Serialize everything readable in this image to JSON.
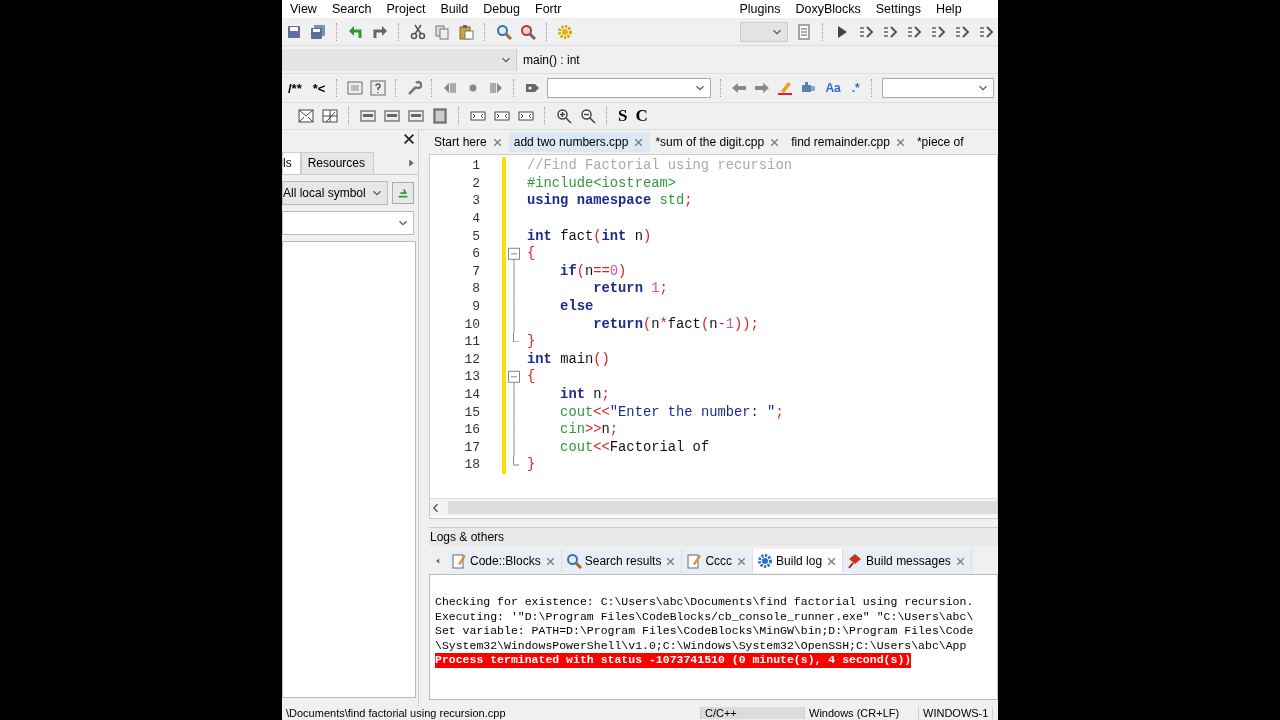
{
  "menu": [
    {
      "label": "View"
    },
    {
      "label": "Search"
    },
    {
      "label": "Project"
    },
    {
      "label": "Build"
    },
    {
      "label": "Debug"
    },
    {
      "label": "Fortr"
    },
    {
      "label": "Plugins"
    },
    {
      "label": "DoxyBlocks"
    },
    {
      "label": "Settings"
    },
    {
      "label": "Help"
    }
  ],
  "toolbars": {
    "comment_buttons": [
      "/**",
      "*<"
    ],
    "regex_buttons": [
      "Aa",
      ".*"
    ],
    "style_buttons": [
      "S",
      "C"
    ],
    "function_field": "main() : int"
  },
  "management": {
    "tabs": [
      {
        "label": "ls",
        "selected": true
      },
      {
        "label": "Resources",
        "selected": false
      }
    ],
    "symbol_filter": "All local symbol"
  },
  "editor_tabs": [
    {
      "label": "Start here",
      "selected": false,
      "closable": true
    },
    {
      "label": "add two numbers.cpp",
      "selected": true,
      "closable": true
    },
    {
      "label": "*sum of the digit.cpp",
      "selected": false,
      "closable": true
    },
    {
      "label": "find remainder.cpp",
      "selected": false,
      "closable": true
    },
    {
      "label": "*piece of",
      "selected": false,
      "closable": false
    }
  ],
  "code_lines": [
    {
      "n": "1",
      "changed": true,
      "tokens": [
        {
          "kind": "comment",
          "text": "//Find Factorial using recursion"
        }
      ]
    },
    {
      "n": "2",
      "changed": true,
      "tokens": [
        {
          "kind": "pre",
          "text": "#include<iostream>"
        }
      ]
    },
    {
      "n": "3",
      "changed": true,
      "tokens": [
        {
          "kind": "kw",
          "text": "using namespace "
        },
        {
          "kind": "lib",
          "text": "std"
        },
        {
          "kind": "op",
          "text": ";"
        }
      ]
    },
    {
      "n": "4",
      "changed": true
    },
    {
      "n": "5",
      "changed": true,
      "tokens": [
        {
          "kind": "kw",
          "text": "int "
        },
        {
          "kind": "plain",
          "text": "fact"
        },
        {
          "kind": "op",
          "text": "("
        },
        {
          "kind": "kw",
          "text": "int "
        },
        {
          "kind": "plain",
          "text": "n"
        },
        {
          "kind": "op",
          "text": ")"
        }
      ]
    },
    {
      "n": "6",
      "kind": "fold_start",
      "changed": true,
      "tokens": [
        {
          "kind": "op",
          "text": "{"
        }
      ]
    },
    {
      "n": "7",
      "kind": "fold_body",
      "changed": true,
      "tokens": [
        {
          "kind": "kw",
          "text": "    if"
        },
        {
          "kind": "op",
          "text": "("
        },
        {
          "kind": "plain",
          "text": "n"
        },
        {
          "kind": "op",
          "text": "=="
        },
        {
          "kind": "num",
          "text": "0"
        },
        {
          "kind": "op",
          "text": ")"
        }
      ]
    },
    {
      "n": "8",
      "kind": "fold_body",
      "changed": true,
      "tokens": [
        {
          "kind": "kw",
          "text": "        return "
        },
        {
          "kind": "num",
          "text": "1"
        },
        {
          "kind": "op",
          "text": ";"
        }
      ]
    },
    {
      "n": "9",
      "kind": "fold_body",
      "changed": true,
      "tokens": [
        {
          "kind": "kw",
          "text": "    else"
        }
      ]
    },
    {
      "n": "10",
      "kind": "fold_body",
      "changed": true,
      "tokens": [
        {
          "kind": "kw",
          "text": "        return"
        },
        {
          "kind": "op",
          "text": "("
        },
        {
          "kind": "plain",
          "text": "n"
        },
        {
          "kind": "op",
          "text": "*"
        },
        {
          "kind": "plain",
          "text": "fact"
        },
        {
          "kind": "op",
          "text": "("
        },
        {
          "kind": "plain",
          "text": "n"
        },
        {
          "kind": "op",
          "text": "-"
        },
        {
          "kind": "num",
          "text": "1"
        },
        {
          "kind": "op",
          "text": "));"
        }
      ]
    },
    {
      "n": "11",
      "kind": "fold_end",
      "changed": true,
      "tokens": [
        {
          "kind": "op",
          "text": "}"
        }
      ]
    },
    {
      "n": "12",
      "changed": true,
      "tokens": [
        {
          "kind": "kw",
          "text": "int "
        },
        {
          "kind": "plain",
          "text": "main"
        },
        {
          "kind": "op",
          "text": "()"
        }
      ]
    },
    {
      "n": "13",
      "kind": "fold_start",
      "changed": true,
      "tokens": [
        {
          "kind": "op",
          "text": "{"
        }
      ]
    },
    {
      "n": "14",
      "kind": "fold_body",
      "changed": true,
      "tokens": [
        {
          "kind": "kw",
          "text": "    int "
        },
        {
          "kind": "plain",
          "text": "n"
        },
        {
          "kind": "op",
          "text": ";"
        }
      ]
    },
    {
      "n": "15",
      "kind": "fold_body",
      "changed": true,
      "tokens": [
        {
          "kind": "lib",
          "text": "    cout"
        },
        {
          "kind": "op",
          "text": "<<"
        },
        {
          "kind": "str",
          "text": "\"Enter the number: \""
        },
        {
          "kind": "op",
          "text": ";"
        }
      ]
    },
    {
      "n": "16",
      "kind": "fold_body",
      "changed": true,
      "tokens": [
        {
          "kind": "lib",
          "text": "    cin"
        },
        {
          "kind": "op",
          "text": ">>"
        },
        {
          "kind": "plain",
          "text": "n"
        },
        {
          "kind": "op",
          "text": ";"
        }
      ]
    },
    {
      "n": "17",
      "kind": "fold_body",
      "changed": true,
      "tokens": [
        {
          "kind": "lib",
          "text": "    cout"
        },
        {
          "kind": "op",
          "text": "<<"
        },
        {
          "kind": "plain",
          "text": "Factorial of"
        }
      ]
    },
    {
      "n": "18",
      "kind": "fold_end",
      "changed": true,
      "tokens": [
        {
          "kind": "op",
          "text": "}"
        }
      ]
    }
  ],
  "logs": {
    "title": "Logs & others",
    "tabs": [
      {
        "label": "Code::Blocks",
        "kind": "note",
        "selected": false
      },
      {
        "label": "Search results",
        "kind": "search",
        "selected": false
      },
      {
        "label": "Cccc",
        "kind": "note",
        "selected": false
      },
      {
        "label": "Build log",
        "kind": "gear",
        "selected": true
      },
      {
        "label": "Build messages",
        "kind": "pin",
        "selected": false
      }
    ],
    "lines": [
      {
        "kind": "info",
        "text": "Checking for existence: C:\\Users\\abc\\Documents\\find factorial using recursion."
      },
      {
        "kind": "info",
        "text": "Executing: '\"D:\\Program Files\\CodeBlocks/cb_console_runner.exe\" \"C:\\Users\\abc\\"
      },
      {
        "kind": "info",
        "text": "Set variable: PATH=D:\\Program Files\\CodeBlocks\\MinGW\\bin;D:\\Program Files\\Code"
      },
      {
        "kind": "info",
        "text": "\\System32\\WindowsPowerShell\\v1.0;C:\\Windows\\System32\\OpenSSH;C:\\Users\\abc\\App"
      },
      {
        "kind": "error",
        "text": "Process terminated with status -1073741510 (0 minute(s), 4 second(s))"
      }
    ]
  },
  "status_bar": {
    "file": "\\Documents\\find factorial using recursion.cpp",
    "language": "C/C++",
    "line_endings": "Windows (CR+LF)",
    "encoding": "WINDOWS-1"
  }
}
